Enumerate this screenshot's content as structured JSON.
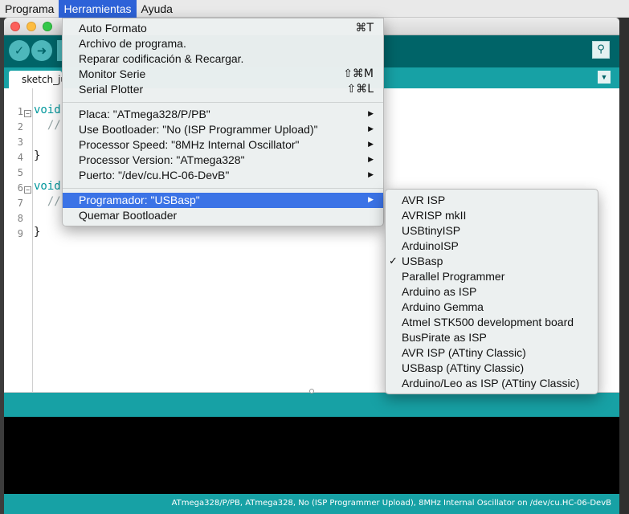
{
  "menubar": {
    "items": [
      {
        "label": "Programa",
        "active": false
      },
      {
        "label": "Herramientas",
        "active": true
      },
      {
        "label": "Ayuda",
        "active": false
      }
    ]
  },
  "window": {
    "tab_label": "sketch_ju",
    "code_lines": [
      {
        "num": "1",
        "keyword": "void",
        "comment": ""
      },
      {
        "num": "2",
        "keyword": "",
        "comment": "  //"
      },
      {
        "num": "3",
        "keyword": "",
        "comment": ""
      },
      {
        "num": "4",
        "keyword": "",
        "comment": "}"
      },
      {
        "num": "5",
        "keyword": "",
        "comment": ""
      },
      {
        "num": "6",
        "keyword": "void",
        "comment": ""
      },
      {
        "num": "7",
        "keyword": "",
        "comment": "  //"
      },
      {
        "num": "8",
        "keyword": "",
        "comment": ""
      },
      {
        "num": "9",
        "keyword": "",
        "comment": "}"
      }
    ],
    "status_text": "ATmega328/P/PB, ATmega328, No (ISP Programmer Upload), 8MHz Internal Oscillator on /dev/cu.HC-06-DevB"
  },
  "tools_menu": {
    "group1": [
      {
        "label": "Auto Formato",
        "shortcut": "⌘T"
      },
      {
        "label": "Archivo de programa.",
        "shortcut": ""
      },
      {
        "label": "Reparar codificación & Recargar.",
        "shortcut": ""
      },
      {
        "label": "Monitor Serie",
        "shortcut": "⇧⌘M"
      },
      {
        "label": "Serial Plotter",
        "shortcut": "⇧⌘L"
      }
    ],
    "group2": [
      {
        "label": "Placa: \"ATmega328/P/PB\""
      },
      {
        "label": "Use Bootloader: \"No (ISP Programmer Upload)\""
      },
      {
        "label": "Processor Speed: \"8MHz Internal Oscillator\""
      },
      {
        "label": "Processor Version: \"ATmega328\""
      },
      {
        "label": "Puerto: \"/dev/cu.HC-06-DevB\""
      }
    ],
    "group3": [
      {
        "label": "Programador: \"USBasp\"",
        "highlighted": true,
        "submenu": true
      },
      {
        "label": "Quemar Bootloader",
        "highlighted": false,
        "submenu": false
      }
    ],
    "submenu_arrow": "▶"
  },
  "programmer_menu": {
    "items": [
      {
        "label": "AVR ISP",
        "checked": false
      },
      {
        "label": "AVRISP mkII",
        "checked": false
      },
      {
        "label": "USBtinyISP",
        "checked": false
      },
      {
        "label": "ArduinoISP",
        "checked": false
      },
      {
        "label": "USBasp",
        "checked": true
      },
      {
        "label": "Parallel Programmer",
        "checked": false
      },
      {
        "label": "Arduino as ISP",
        "checked": false
      },
      {
        "label": "Arduino Gemma",
        "checked": false
      },
      {
        "label": "Atmel STK500 development board",
        "checked": false
      },
      {
        "label": "BusPirate as ISP",
        "checked": false
      },
      {
        "label": "AVR ISP (ATtiny Classic)",
        "checked": false
      },
      {
        "label": "USBasp (ATtiny Classic)",
        "checked": false
      },
      {
        "label": "Arduino/Leo as ISP (ATtiny Classic)",
        "checked": false
      }
    ],
    "check_glyph": "✓"
  },
  "colors": {
    "toolbar": "#006468",
    "tabbar": "#17a1a5",
    "highlight": "#3b73e6",
    "menubar_active": "#2d62d8"
  },
  "icons": {
    "verify": "checkmark-icon",
    "upload": "arrow-right-icon",
    "serial_monitor": "magnifier-icon",
    "tab_menu": "triangle-down-icon"
  }
}
